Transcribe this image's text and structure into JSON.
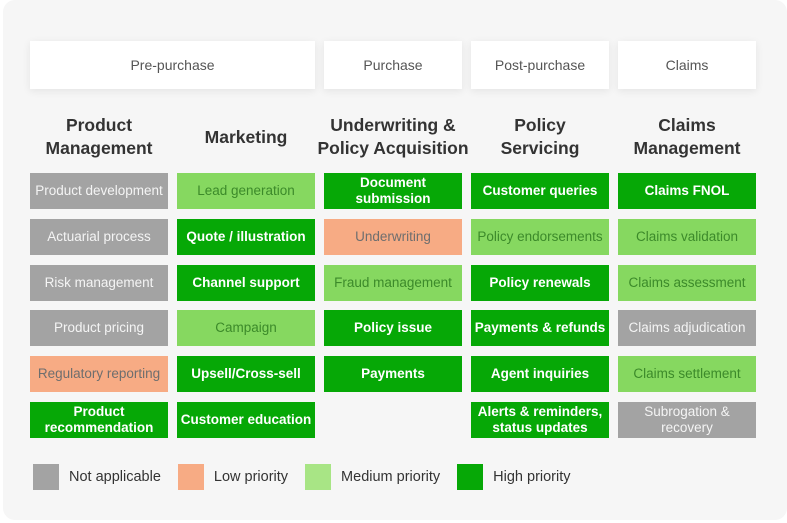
{
  "phases": [
    {
      "label": "Pre-purchase"
    },
    {
      "label": "Purchase"
    },
    {
      "label": "Post-purchase"
    },
    {
      "label": "Claims"
    }
  ],
  "columns": [
    {
      "title": "Product Management",
      "title_lines": [
        "Product",
        "Management"
      ],
      "cells": [
        {
          "label": "Product development",
          "priority": "na"
        },
        {
          "label": "Actuarial process",
          "priority": "na"
        },
        {
          "label": "Risk management",
          "priority": "na"
        },
        {
          "label": "Product pricing",
          "priority": "na"
        },
        {
          "label": "Regulatory reporting",
          "priority": "low"
        },
        {
          "label": "Product recommendation",
          "priority": "high"
        }
      ]
    },
    {
      "title": "Marketing",
      "title_lines": [
        "Marketing"
      ],
      "cells": [
        {
          "label": "Lead generation",
          "priority": "med"
        },
        {
          "label": "Quote / illustration",
          "priority": "high"
        },
        {
          "label": "Channel support",
          "priority": "high"
        },
        {
          "label": "Campaign",
          "priority": "med"
        },
        {
          "label": "Upsell/Cross-sell",
          "priority": "high"
        },
        {
          "label": "Customer education",
          "priority": "high"
        }
      ]
    },
    {
      "title": "Underwriting & Policy Acquisition",
      "title_lines": [
        "Underwriting &",
        "Policy Acquisition"
      ],
      "cells": [
        {
          "label": "Document submission",
          "priority": "high"
        },
        {
          "label": "Underwriting",
          "priority": "low"
        },
        {
          "label": "Fraud management",
          "priority": "med"
        },
        {
          "label": "Policy issue",
          "priority": "high"
        },
        {
          "label": "Payments",
          "priority": "high"
        }
      ]
    },
    {
      "title": "Policy Servicing",
      "title_lines": [
        "Policy",
        "Servicing"
      ],
      "cells": [
        {
          "label": "Customer queries",
          "priority": "high"
        },
        {
          "label": "Policy endorsements",
          "priority": "med"
        },
        {
          "label": "Policy renewals",
          "priority": "high"
        },
        {
          "label": "Payments & refunds",
          "priority": "high"
        },
        {
          "label": "Agent inquiries",
          "priority": "high"
        },
        {
          "label": "Alerts & reminders, status updates",
          "priority": "high"
        }
      ]
    },
    {
      "title": "Claims Management",
      "title_lines": [
        "Claims",
        "Management"
      ],
      "cells": [
        {
          "label": "Claims FNOL",
          "priority": "high"
        },
        {
          "label": "Claims validation",
          "priority": "med"
        },
        {
          "label": "Claims assessment",
          "priority": "med"
        },
        {
          "label": "Claims adjudication",
          "priority": "na"
        },
        {
          "label": "Claims settlement",
          "priority": "med"
        },
        {
          "label": "Subrogation & recovery",
          "priority": "na"
        }
      ]
    }
  ],
  "legend": [
    {
      "key": "na",
      "label": "Not applicable",
      "color": "#a3a3a3"
    },
    {
      "key": "low",
      "label": "Low priority",
      "color": "#f7ab84"
    },
    {
      "key": "med",
      "label": "Medium priority",
      "color": "#a8e585"
    },
    {
      "key": "high",
      "label": "High priority",
      "color": "#06a806"
    }
  ]
}
